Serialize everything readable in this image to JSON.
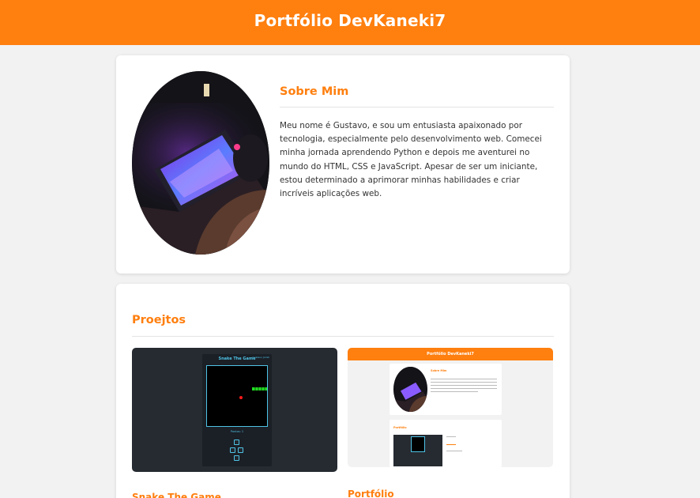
{
  "header": {
    "title": "Portfólio DevKaneki7"
  },
  "about": {
    "title": "Sobre Mim",
    "text": "Meu nome é Gustavo, e sou um entusiasta apaixonado por tecnologia, especialmente pelo desenvolvimento web. Comecei minha jornada aprendendo Python e depois me aventurei no mundo do HTML, CSS e JavaScript. Apesar de ser um iniciante, estou determinado a aprimorar minhas habilidades e criar incríveis aplicações web.",
    "photo_icon": "profile-photo-gaming-setup"
  },
  "projects": {
    "title": "Proejtos",
    "items": [
      {
        "label": "Snake The Game",
        "preview": {
          "title": "Snake The Game",
          "author": "Gustavo Jomili",
          "score": "Pontos: 1"
        }
      },
      {
        "label": "Portfólio",
        "preview": {
          "header": "Portfólio DevKaneki7",
          "about_title": "Sobre Mim",
          "projects_title": "Portfólio"
        }
      }
    ]
  },
  "colors": {
    "accent": "#ff7f0f",
    "background": "#f2f2f2",
    "card": "#ffffff",
    "snake_frame": "#4fc3e6",
    "snake_body": "#22dd22",
    "food": "#ff1a1a"
  }
}
